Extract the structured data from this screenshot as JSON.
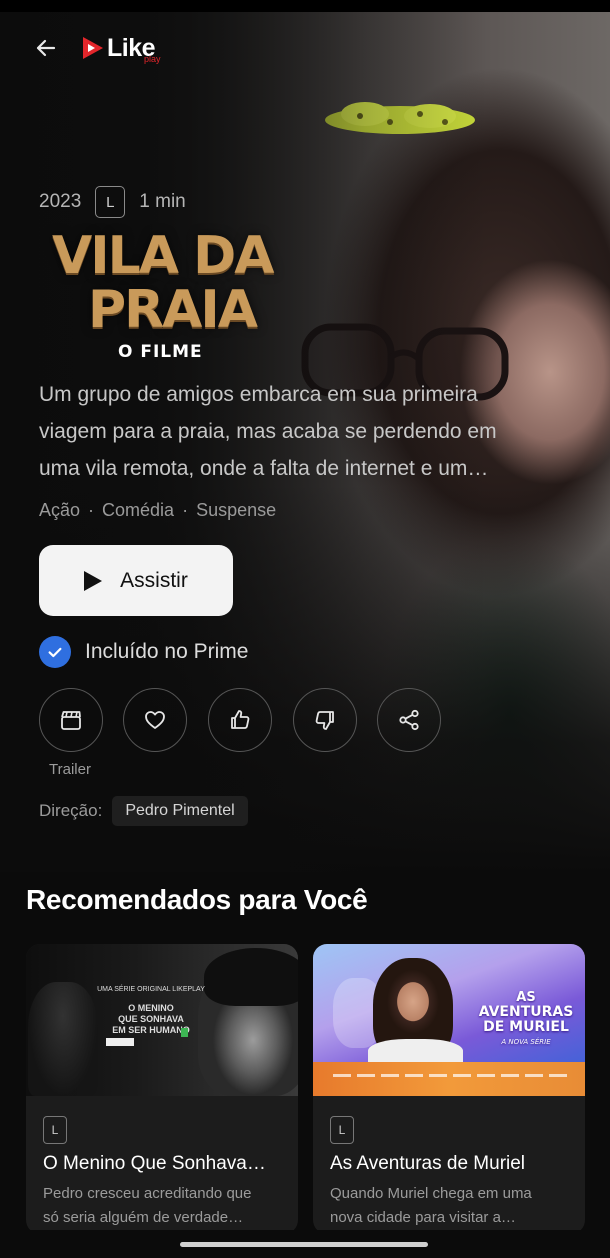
{
  "header": {
    "logo_text": "Like",
    "logo_sub": "play",
    "back_icon": "arrow-left-icon"
  },
  "movie": {
    "year": "2023",
    "rating": "L",
    "duration": "1 min",
    "title_line1": "VILA DA",
    "title_line2": "PRAIA",
    "title_line3": "O FILME",
    "description_lines": [
      "Um grupo de amigos embarca em sua primeira",
      "viagem para a praia, mas acaba se perdendo em",
      "uma vila remota, onde a falta de internet e um…"
    ],
    "genres": [
      "Ação",
      "Comédia",
      "Suspense"
    ],
    "genre_separator": "·",
    "play_label": "Assistir",
    "prime_label": "Incluído no Prime",
    "trailer_label": "Trailer",
    "direction_label": "Direção:",
    "director": "Pedro Pimentel"
  },
  "actions": [
    {
      "name": "trailer",
      "icon": "clapperboard-icon"
    },
    {
      "name": "favorite",
      "icon": "heart-icon"
    },
    {
      "name": "like",
      "icon": "thumbs-up-icon"
    },
    {
      "name": "dislike",
      "icon": "thumbs-down-icon"
    },
    {
      "name": "share",
      "icon": "share-icon"
    }
  ],
  "recommendations": {
    "heading": "Recomendados para Você",
    "items": [
      {
        "rating": "L",
        "title": "O Menino Que Sonhava…",
        "description_lines": [
          "Pedro cresceu acreditando que",
          "só seria alguém de verdade…"
        ],
        "thumb_kicker": "UMA SÉRIE ORIGINAL LIKEPLAY",
        "thumb_title": [
          "O MENINO",
          "QUE SONHAVA",
          "EM SER HUMANO"
        ]
      },
      {
        "rating": "L",
        "title": "As Aventuras de Muriel",
        "description_lines": [
          "Quando Muriel chega em uma",
          "nova cidade para visitar a…"
        ],
        "thumb_title": [
          "AS",
          "AVENTURAS",
          "DE MURIEL"
        ],
        "thumb_sub": "A NOVA SÉRIE"
      }
    ]
  },
  "colors": {
    "background": "#0b0b0b",
    "accent_red": "#e3262b",
    "prime_blue": "#2f6fe0",
    "title_gold": "#c99a5a"
  }
}
